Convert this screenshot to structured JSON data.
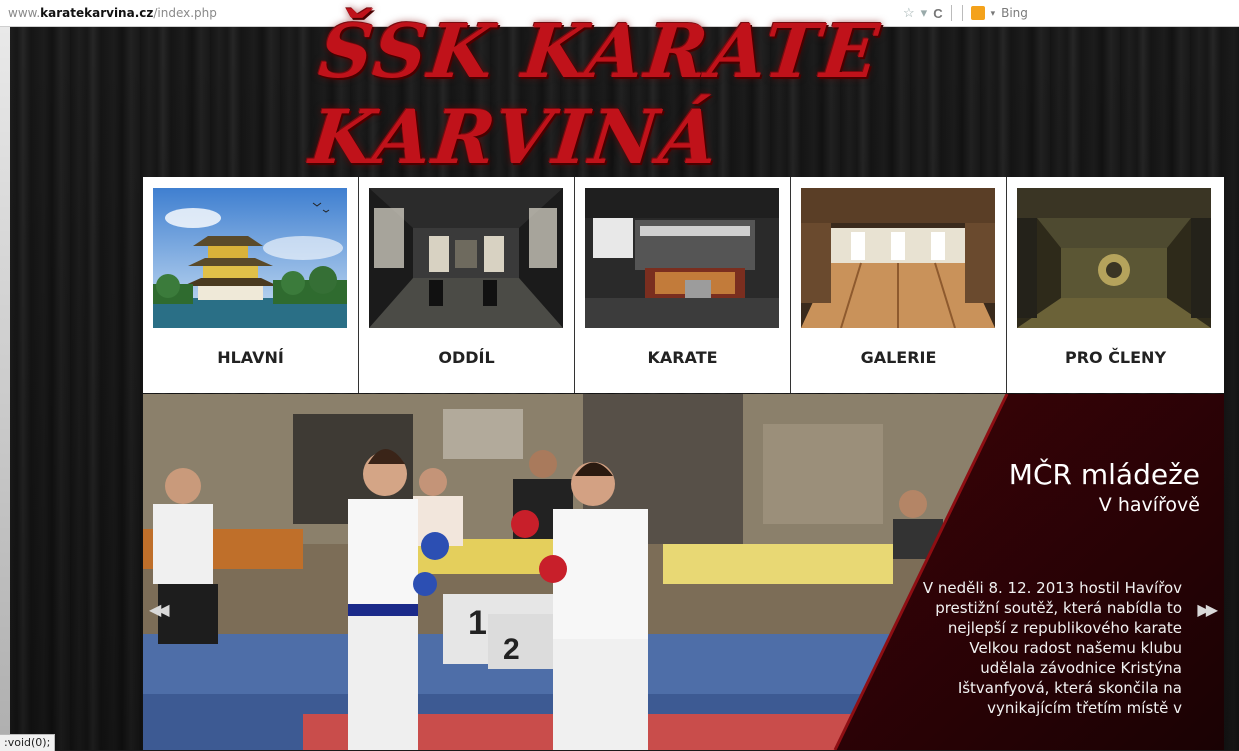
{
  "browser": {
    "url_prefix": "www.",
    "url_host": "karatekarvina.cz",
    "url_path": "/index.php",
    "search_engine": "Bing"
  },
  "site": {
    "logo_text": "ŠSK KARATE KARVINÁ",
    "accent_color": "#c0121a"
  },
  "nav": {
    "items": [
      {
        "label": "HLAVNÍ"
      },
      {
        "label": "ODDÍL"
      },
      {
        "label": "KARATE"
      },
      {
        "label": "GALERIE"
      },
      {
        "label": "PRO ČLENY"
      }
    ]
  },
  "slider": {
    "title": "MČR mládeže",
    "subtitle": "V havířově",
    "body": "V neděli 8. 12. 2013 hostil Havířov prestižní soutěž, která nabídla to nejlepší z republikového karate Velkou radost našemu klubu udělala závodnice Kristýna Ištvanfyová, která skončila na vynikajícím třetím místě v",
    "prev": "◀◀",
    "next": "▶▶"
  },
  "status": {
    "text": ":void(0);"
  }
}
